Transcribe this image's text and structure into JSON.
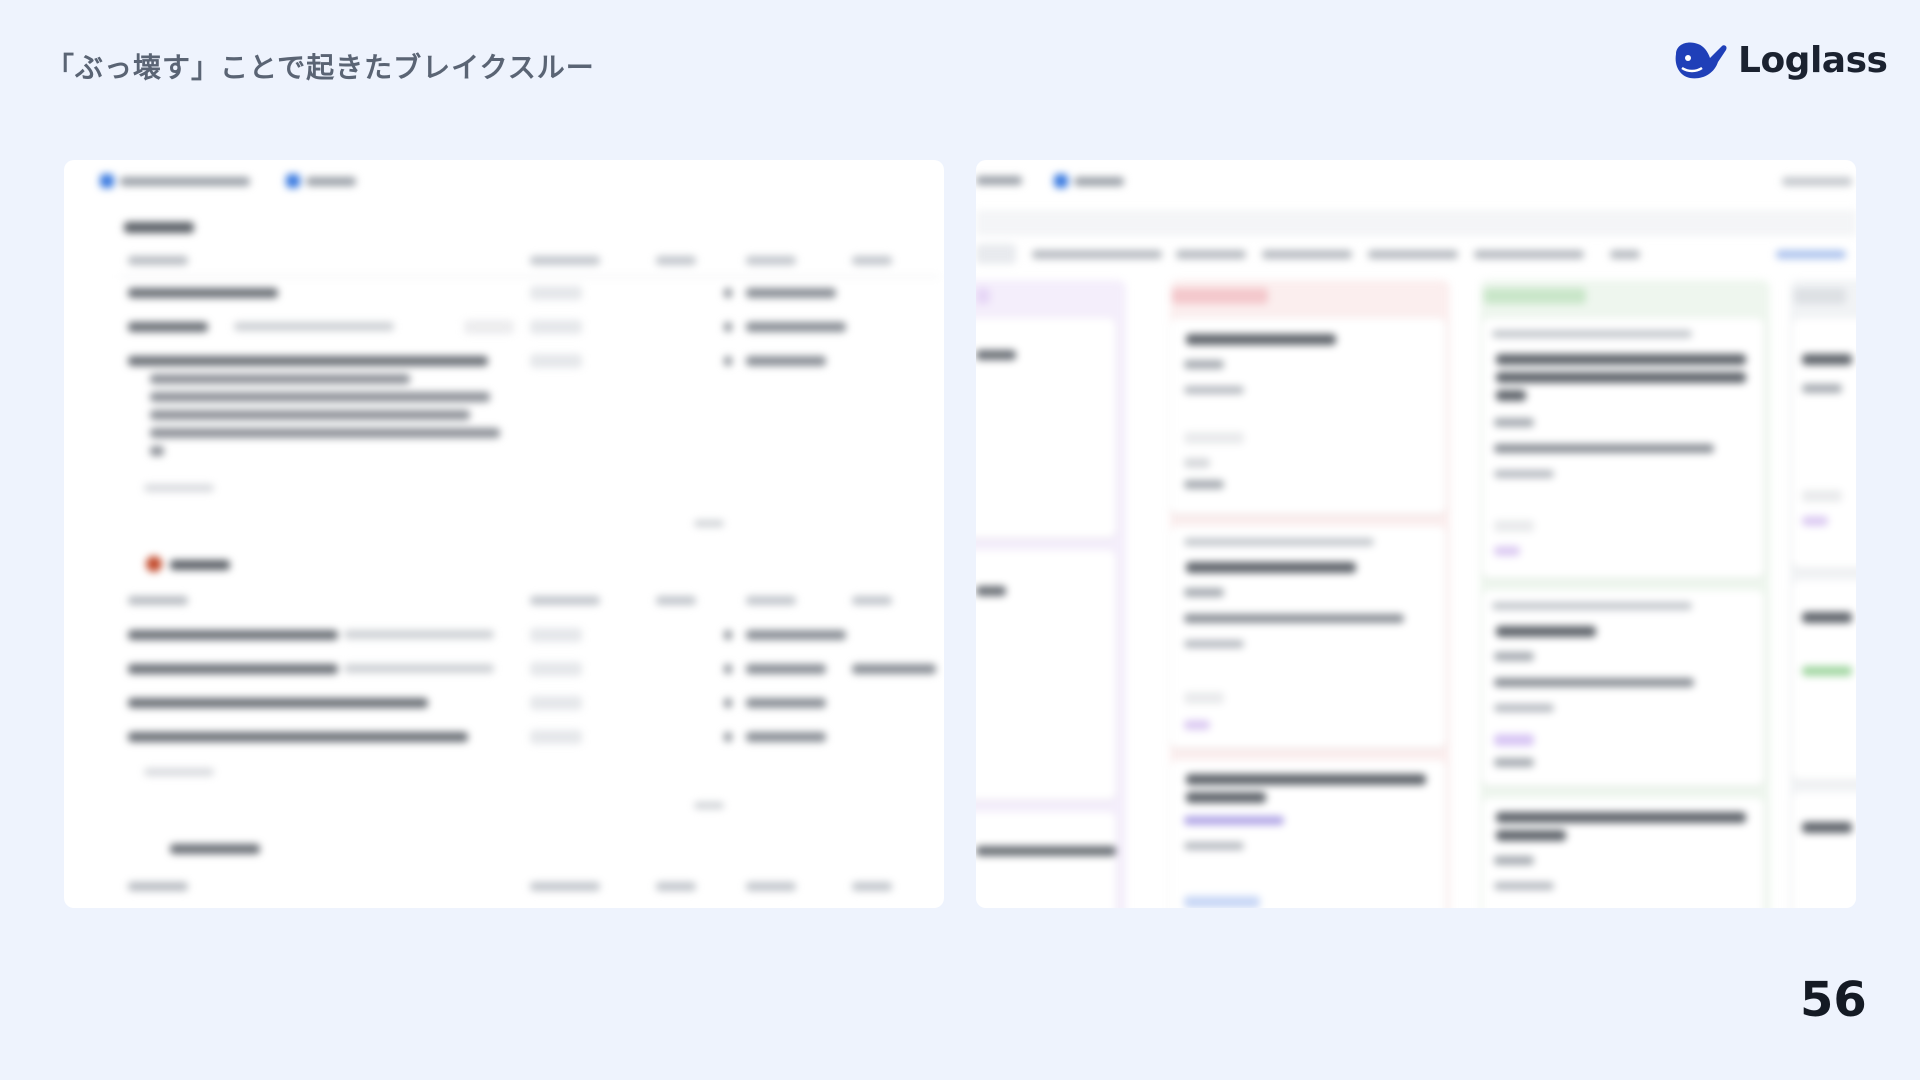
{
  "slide": {
    "title": "「ぶっ壊す」ことで起きたブレイクスルー",
    "page_number": "56"
  },
  "logo": {
    "name": "Loglass",
    "icon": "whale-icon",
    "brand_color": "#1f3fb8"
  },
  "screenshots": {
    "left": {
      "description_icon": "blurred-table-screenshot"
    },
    "right": {
      "description_icon": "blurred-kanban-screenshot",
      "column_colors": [
        "#f4eefb",
        "#fbeeee",
        "#eef6ee",
        "#f1f3f5"
      ]
    }
  }
}
